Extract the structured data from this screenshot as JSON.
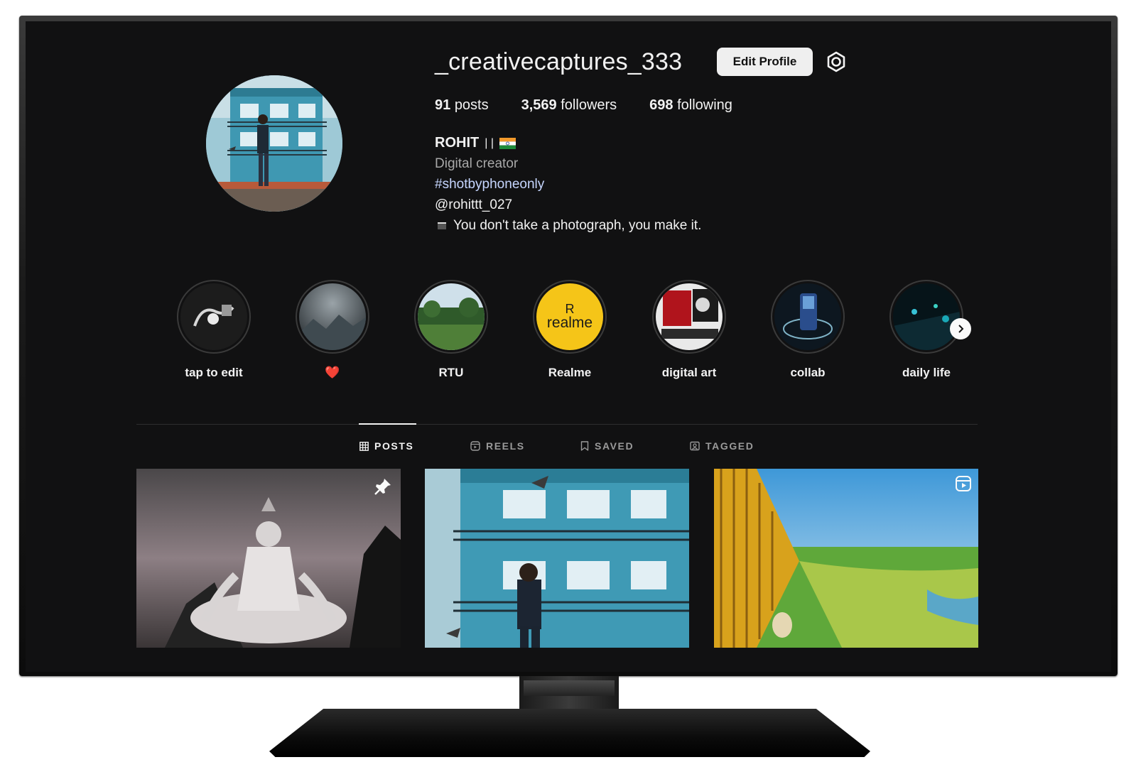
{
  "profile": {
    "username": "_creativecaptures_333",
    "edit_button": "Edit Profile",
    "settings_icon": "gear-icon",
    "stats": [
      {
        "count": "91",
        "label": "posts"
      },
      {
        "count": "3,569",
        "label": "followers"
      },
      {
        "count": "698",
        "label": "following"
      }
    ],
    "display_name": "ROHIT",
    "display_name_suffix": "| |",
    "category": "Digital creator",
    "hashtag": "#shotbyphoneonly",
    "mention": "@rohittt_027",
    "quote": "You don't take a photograph, you make it."
  },
  "highlights": [
    {
      "label": "tap to edit"
    },
    {
      "label": "❤️"
    },
    {
      "label": "RTU"
    },
    {
      "label": "Realme",
      "logo_text": "realme",
      "logo_mark": "R",
      "color": "#f5c518"
    },
    {
      "label": "digital art"
    },
    {
      "label": "collab"
    },
    {
      "label": "daily life"
    }
  ],
  "tabs": [
    {
      "label": "POSTS",
      "icon": "grid-icon",
      "active": true
    },
    {
      "label": "REELS",
      "icon": "reels-icon",
      "active": false
    },
    {
      "label": "SAVED",
      "icon": "bookmark-icon",
      "active": false
    },
    {
      "label": "TAGGED",
      "icon": "tagged-icon",
      "active": false
    }
  ],
  "posts": [
    {
      "badge_icon": "pin-icon"
    },
    {
      "badge_icon": ""
    },
    {
      "badge_icon": "reel-icon"
    }
  ],
  "colors": {
    "background": "#111112",
    "text": "#f2f2f2",
    "muted": "#a8a8a8",
    "link": "#c6d6ff",
    "realme_yellow": "#f5c518"
  }
}
